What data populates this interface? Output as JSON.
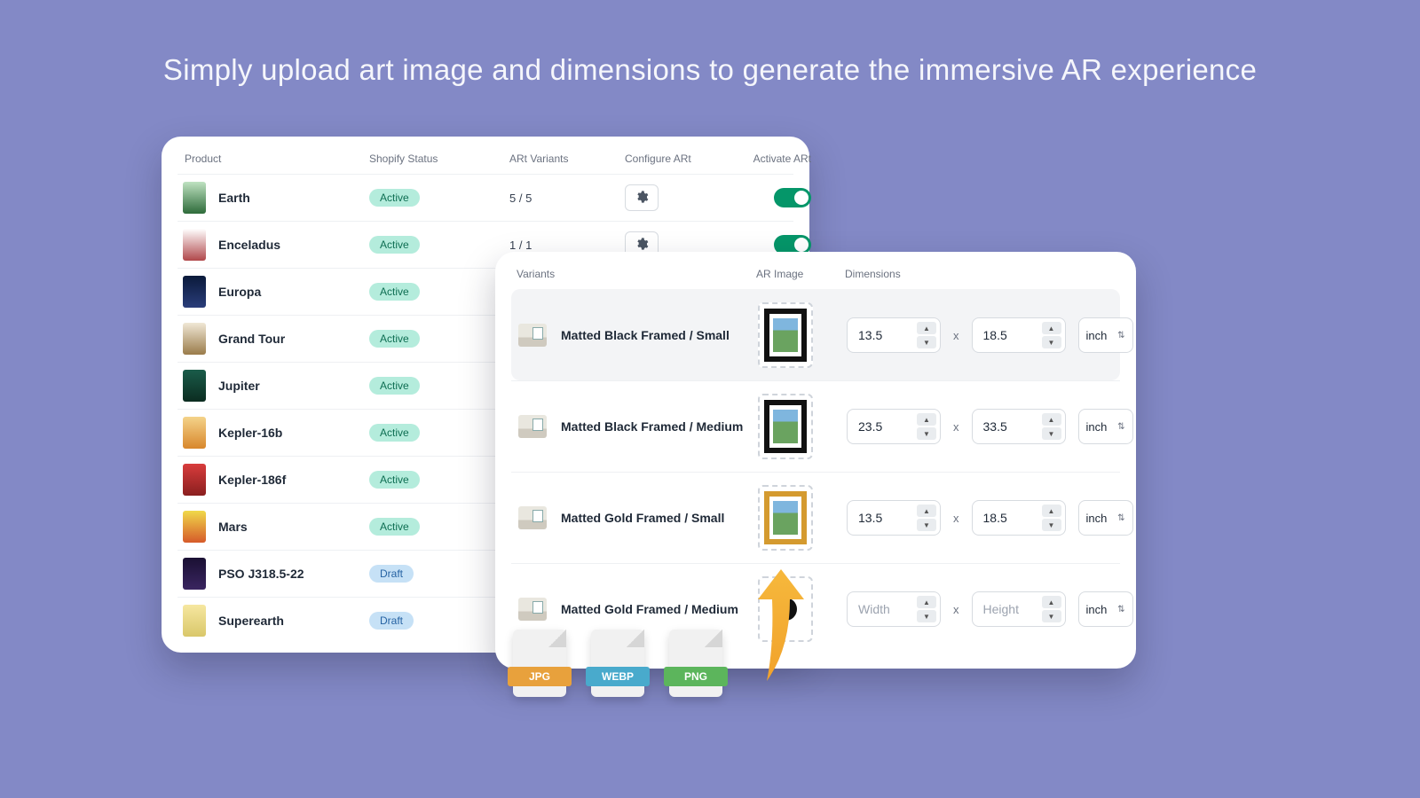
{
  "headline": "Simply upload art image and dimensions to generate the immersive AR experience",
  "productsTable": {
    "headers": {
      "product": "Product",
      "status": "Shopify Status",
      "variants": "ARt Variants",
      "configure": "Configure ARt",
      "activate": "Activate ARt"
    },
    "rows": [
      {
        "name": "Earth",
        "status": "Active",
        "statusKind": "active",
        "variants": "5 / 5",
        "gear": true,
        "toggle": true,
        "thumb": "linear-gradient(#bfe2c1,#2e6b3a)"
      },
      {
        "name": "Enceladus",
        "status": "Active",
        "statusKind": "active",
        "variants": "1 / 1",
        "gear": true,
        "toggle": true,
        "thumb": "linear-gradient(#fff,#b0474a)"
      },
      {
        "name": "Europa",
        "status": "Active",
        "statusKind": "active",
        "variants": "",
        "gear": false,
        "toggle": false,
        "thumb": "linear-gradient(#0a1a3a,#2a3d7a)"
      },
      {
        "name": "Grand Tour",
        "status": "Active",
        "statusKind": "active",
        "variants": "",
        "gear": false,
        "toggle": false,
        "thumb": "linear-gradient(#f0e7d6,#9a7b4a)"
      },
      {
        "name": "Jupiter",
        "status": "Active",
        "statusKind": "active",
        "variants": "",
        "gear": false,
        "toggle": false,
        "thumb": "linear-gradient(#1a5c4a,#0b2c20)"
      },
      {
        "name": "Kepler-16b",
        "status": "Active",
        "statusKind": "active",
        "variants": "",
        "gear": false,
        "toggle": false,
        "thumb": "linear-gradient(#f4d38a,#d8872c)"
      },
      {
        "name": "Kepler-186f",
        "status": "Active",
        "statusKind": "active",
        "variants": "",
        "gear": false,
        "toggle": false,
        "thumb": "linear-gradient(#d83c3c,#8a1f1f)"
      },
      {
        "name": "Mars",
        "status": "Active",
        "statusKind": "active",
        "variants": "",
        "gear": false,
        "toggle": false,
        "thumb": "linear-gradient(#f0d94a,#d65a2a)"
      },
      {
        "name": "PSO J318.5-22",
        "status": "Draft",
        "statusKind": "draft",
        "variants": "",
        "gear": false,
        "toggle": false,
        "thumb": "linear-gradient(#1a1033,#3a2560)"
      },
      {
        "name": "Superearth",
        "status": "Draft",
        "statusKind": "draft",
        "variants": "",
        "gear": false,
        "toggle": false,
        "thumb": "linear-gradient(#f6e7a0,#d9c76a)"
      }
    ]
  },
  "variantsPanel": {
    "headers": {
      "variants": "Variants",
      "arImage": "AR Image",
      "dimensions": "Dimensions"
    },
    "dimX": "x",
    "unit": "inch",
    "widthPlaceholder": "Width",
    "heightPlaceholder": "Height",
    "rows": [
      {
        "name": "Matted Black Framed / Small",
        "frame": "black",
        "selected": true,
        "width": "13.5",
        "height": "18.5",
        "hasImage": true
      },
      {
        "name": "Matted Black Framed / Medium",
        "frame": "black",
        "selected": false,
        "width": "23.5",
        "height": "33.5",
        "hasImage": true
      },
      {
        "name": "Matted Gold Framed / Small",
        "frame": "gold",
        "selected": false,
        "width": "13.5",
        "height": "18.5",
        "hasImage": true
      },
      {
        "name": "Matted Gold Framed / Medium",
        "frame": "gold",
        "selected": false,
        "width": "",
        "height": "",
        "hasImage": false
      }
    ]
  },
  "fileTypes": {
    "jpg": "JPG",
    "webp": "WEBP",
    "png": "PNG"
  }
}
